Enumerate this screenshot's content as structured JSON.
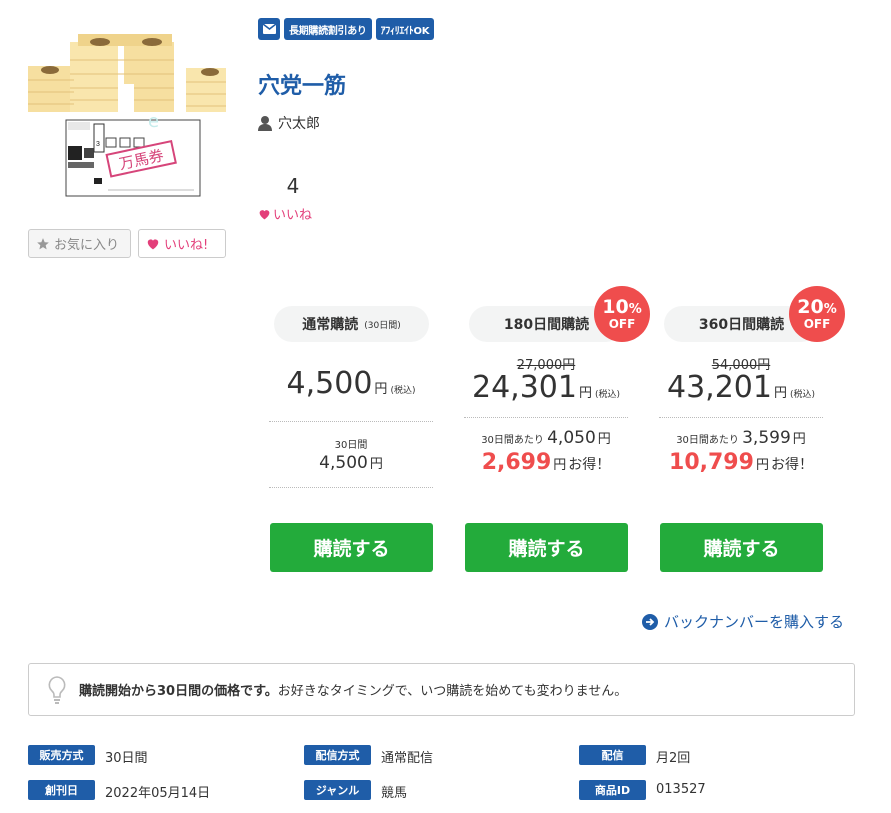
{
  "badges": {
    "mail_icon": "mail-icon",
    "long_term": "長期購読割引あり",
    "affiliate": "ｱﾌｨﾘｴｲﾄOK"
  },
  "title": "穴党一筋",
  "author": "穴太郎",
  "likes": {
    "count": "4",
    "label": "いいね"
  },
  "buttons": {
    "favorite": "お気に入り",
    "like": "いいね!"
  },
  "plans": [
    {
      "name": "通常購読",
      "sub": "(30日間)",
      "strike": "",
      "price": "4,500",
      "yen": "円",
      "tax": "(税込)",
      "per_label": "30日間",
      "per_value": "4,500",
      "per_yen": "円",
      "save": "",
      "save_yen": "",
      "otoku": "",
      "button": "購読する"
    },
    {
      "name": "180日間購読",
      "discount": "10",
      "strike": "27,000円",
      "price": "24,301",
      "yen": "円",
      "tax": "(税込)",
      "per_label": "30日間あたり",
      "per_value": "4,050",
      "per_yen": "円",
      "save": "2,699",
      "save_yen": "円",
      "otoku": "お得！",
      "button": "購読する"
    },
    {
      "name": "360日間購読",
      "discount": "20",
      "strike": "54,000円",
      "price": "43,201",
      "yen": "円",
      "tax": "(税込)",
      "per_label": "30日間あたり",
      "per_value": "3,599",
      "per_yen": "円",
      "save": "10,799",
      "save_yen": "円",
      "otoku": "お得！",
      "button": "購読する"
    }
  ],
  "discount_unit": "%",
  "discount_off": "OFF",
  "backnumber": "バックナンバーを購入する",
  "note": {
    "bold": "購読開始から30日間の価格です。",
    "text": "お好きなタイミングで、いつ購読を始めても変わりません。"
  },
  "meta": [
    {
      "label": "販売方式",
      "value": "30日間"
    },
    {
      "label": "配信方式",
      "value": "通常配信"
    },
    {
      "label": "配信",
      "value": "月2回"
    },
    {
      "label": "創刊日",
      "value": "2022年05月14日"
    },
    {
      "label": "ジャンル",
      "value": "競馬"
    },
    {
      "label": "商品ID",
      "value": "013527"
    }
  ],
  "thumbnail": {
    "ticket_text": "万馬券"
  },
  "colors": {
    "brand": "#1f5da8",
    "buy": "#23ab3b",
    "discount": "#ef4d4d",
    "like": "#e33f7a"
  }
}
